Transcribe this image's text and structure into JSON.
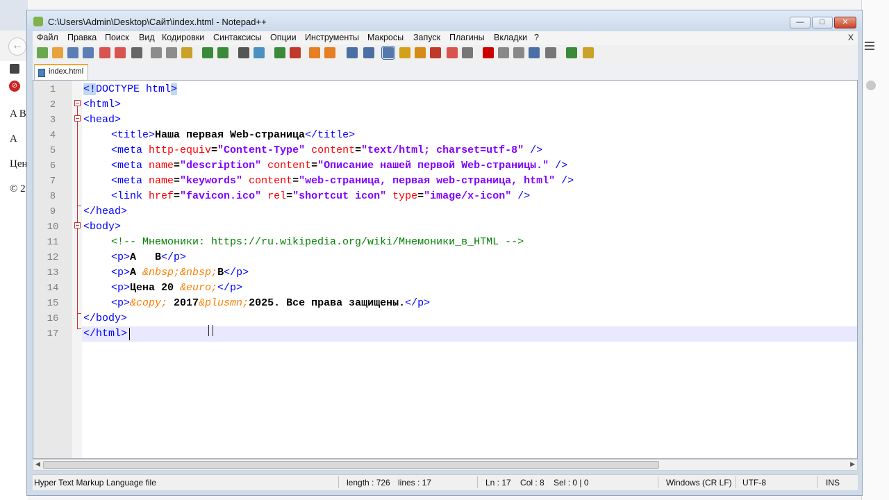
{
  "background_page": {
    "lines": [
      "A B",
      "A",
      "Цен",
      "© 2"
    ]
  },
  "window": {
    "title": "C:\\Users\\Admin\\Desktop\\Сайт\\index.html - Notepad++"
  },
  "menu": [
    "Файл",
    "Правка",
    "Поиск",
    "Вид",
    "Кодировки",
    "Синтаксисы",
    "Опции",
    "Инструменты",
    "Макросы",
    "Запуск",
    "Плагины",
    "Вкладки",
    "?"
  ],
  "menu_close": "X",
  "tab": {
    "label": "index.html"
  },
  "editor": {
    "lines": [
      {
        "n": "1"
      },
      {
        "n": "2"
      },
      {
        "n": "3"
      },
      {
        "n": "4"
      },
      {
        "n": "5"
      },
      {
        "n": "6"
      },
      {
        "n": "7"
      },
      {
        "n": "8"
      },
      {
        "n": "9"
      },
      {
        "n": "10"
      },
      {
        "n": "11"
      },
      {
        "n": "12"
      },
      {
        "n": "13"
      },
      {
        "n": "14"
      },
      {
        "n": "15"
      },
      {
        "n": "16"
      },
      {
        "n": "17"
      }
    ],
    "code": {
      "l1": [
        "<!",
        "DOCTYPE html",
        ">"
      ],
      "l2": "<html>",
      "l3": "<head>",
      "l4": [
        "<title>",
        "Наша первая Web-страница",
        "</title>"
      ],
      "l5": [
        "<meta ",
        "http-equiv",
        "=",
        "\"Content-Type\"",
        " content",
        "=",
        "\"text/html; charset=utf-8\"",
        " />"
      ],
      "l6": [
        "<meta ",
        "name",
        "=",
        "\"description\"",
        " content",
        "=",
        "\"Описание нашей первой Web-страницы.\"",
        " />"
      ],
      "l7": [
        "<meta ",
        "name",
        "=",
        "\"keywords\"",
        " content",
        "=",
        "\"web-страница, первая web-страница, html\"",
        " />"
      ],
      "l8": [
        "<link ",
        "href",
        "=",
        "\"favicon.ico\"",
        " rel",
        "=",
        "\"shortcut icon\"",
        " type",
        "=",
        "\"image/x-icon\"",
        " />"
      ],
      "l9": "</head>",
      "l10": "<body>",
      "l11": "<!-- Мнемоники: https://ru.wikipedia.org/wiki/Мнемоники_в_HTML -->",
      "l12": [
        "<p>",
        "A   B",
        "</p>"
      ],
      "l13": [
        "<p>",
        "A ",
        "&nbsp;&nbsp;",
        "B",
        "</p>"
      ],
      "l14": [
        "<p>",
        "Цена 20 ",
        "&euro;",
        "</p>"
      ],
      "l15": [
        "<p>",
        "&copy;",
        " 2017",
        "&plusmn;",
        "2025. Все права защищены.",
        "</p>"
      ],
      "l16": "</body>",
      "l17": "</html>"
    }
  },
  "status": {
    "filetype": "Hyper Text Markup Language file",
    "length": "length : 726",
    "lines": "lines : 17",
    "position": "Ln : 17    Col : 8    Sel : 0 | 0",
    "eol": "Windows (CR LF)",
    "encoding": "UTF-8",
    "mode": "INS"
  },
  "toolbar_icons": [
    "new-file-icon",
    "open-file-icon",
    "save-icon",
    "save-all-icon",
    "close-icon",
    "close-all-icon",
    "print-icon",
    "cut-icon",
    "copy-icon",
    "paste-icon",
    "undo-icon",
    "redo-icon",
    "find-icon",
    "replace-icon",
    "zoom-in-icon",
    "zoom-out-icon",
    "sync-v-icon",
    "sync-h-icon",
    "wrap-icon",
    "show-all-chars-icon",
    "indent-guide-icon",
    "user-lang-icon",
    "doc-map-icon",
    "function-list-icon",
    "folder-workspace-icon",
    "monitor-icon",
    "record-macro-icon",
    "stop-macro-icon",
    "play-macro-icon",
    "run-macro-multi-icon",
    "save-macro-icon",
    "spellcheck-icon",
    "plugin-icon"
  ]
}
